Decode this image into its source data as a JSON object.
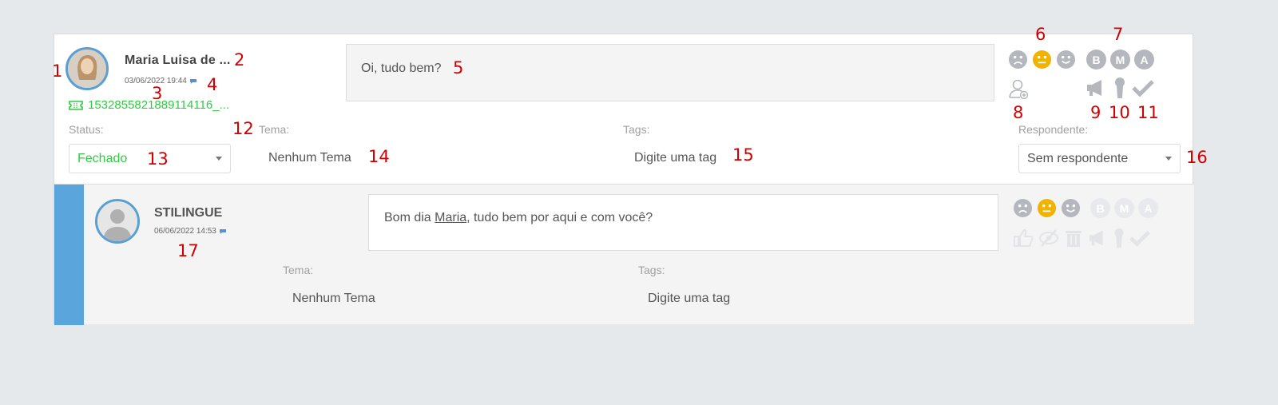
{
  "message1": {
    "author": "Maria Luisa de ...",
    "timestamp": "03/06/2022 19:44",
    "ticket_id": "1532855821889114116_...",
    "text": "Oi, tudo bem?",
    "fields": {
      "status_label": "Status:",
      "status_value": "Fechado",
      "tema_label": "Tema:",
      "tema_value": "Nenhum Tema",
      "tags_label": "Tags:",
      "tags_placeholder": "Digite uma tag",
      "respondente_label": "Respondente:",
      "respondente_value": "Sem respondente"
    },
    "sentiment_selected": "neutral",
    "priority_letters": [
      "B",
      "M",
      "A"
    ]
  },
  "message2": {
    "author": "STILINGUE",
    "timestamp": "06/06/2022 14:53",
    "text_before": "Bom dia ",
    "mention": "Maria",
    "text_after": ", tudo bem por aqui e com você?",
    "fields": {
      "tema_label": "Tema:",
      "tema_value": "Nenhum Tema",
      "tags_label": "Tags:",
      "tags_placeholder": "Digite uma tag"
    },
    "priority_letters": [
      "B",
      "M",
      "A"
    ]
  },
  "annotations": [
    "1",
    "2",
    "3",
    "4",
    "5",
    "6",
    "7",
    "8",
    "9",
    "10",
    "11",
    "12",
    "13",
    "14",
    "15",
    "16",
    "17"
  ],
  "colors": {
    "accent_blue": "#5aa5dc",
    "status_green": "#2ecc40",
    "neutral_selected": "#f0b400",
    "icon_gray": "#b4b8be",
    "annotation_red": "#d40000"
  }
}
